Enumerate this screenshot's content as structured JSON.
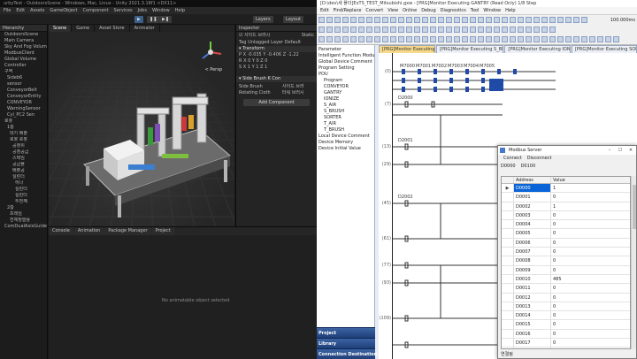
{
  "unity": {
    "title": "urbyTest - OutdoorsScene - Windows, Mac, Linux - Unity 2021.3.18f1 <DX11>",
    "menu": [
      "File",
      "Edit",
      "Assets",
      "GameObject",
      "Component",
      "Services",
      "Jobs",
      "Window",
      "Help"
    ],
    "toolbar": {
      "layers": "Layers",
      "layout": "Layout"
    },
    "hierarchy": {
      "tab": "Hierarchy",
      "items": [
        "OutdoorsScene",
        "Main Camera",
        "Sky And Fog Volume",
        "ModbusClient",
        "Global Volume",
        "Controller",
        "구역",
        "Sideb6",
        "sensor",
        "ConveyorBelt",
        "ConveyorEntity",
        "CONVEYOR",
        "WarningSensor",
        "Cyl_PC2 Sen",
        "로봇",
        "1층",
        "대기 배출",
        "로봇 로봇",
        "공정위",
        "공정공급",
        "스택임",
        "공급폴",
        "배출공",
        "실린더",
        "하나",
        "실린더",
        "실린더",
        "두번째",
        "2층",
        "프레임",
        "전체정렬용",
        "ComDualAxisGuide"
      ]
    },
    "scene": {
      "tabs": [
        "Scene",
        "Game",
        "Asset Store",
        "Animator"
      ],
      "persp_label": "< Persp"
    },
    "inspector": {
      "tab": "Inspector",
      "object_name": "사이드 브러시",
      "static_label": "Static",
      "tag_label": "Tag",
      "tag_value": "Untagged",
      "layer_label": "Layer",
      "layer_value": "Default",
      "transform_label": "Transform",
      "rows": [
        {
          "axis": "P",
          "x": "X -0.035",
          "y": "Y -0.406",
          "z": "Z -1.22"
        },
        {
          "axis": "R",
          "x": "X 0",
          "y": "Y 0",
          "z": "Z 0"
        },
        {
          "axis": "S",
          "x": "X 1",
          "y": "Y 1",
          "z": "Z 1"
        }
      ],
      "component_label": "Side Brush K Con",
      "side_brush_label": "Side Brush",
      "side_brush_value": "사이드 브러",
      "rotating_label": "Rotating Cloth",
      "rotating_value": "타워 브러시",
      "add_component": "Add Component"
    },
    "console": {
      "tabs": [
        "Console",
        "Animation",
        "Package Manager",
        "Project"
      ],
      "empty_text": "No animatable object selected"
    }
  },
  "gx": {
    "title": "[PRG]Monitor Executing GANTRY (Read Only) 1/8 Step",
    "path_text": "[D:\\dev\\새 폴더]ExTS_TEST_Mitsubishi.gxw",
    "menu": [
      "Edit",
      "Find/Replace",
      "Convert",
      "View",
      "Online",
      "Debug",
      "Diagnostics",
      "Tool",
      "Window",
      "Help"
    ],
    "zoom": "100.000ms",
    "nav_items": [
      "Parameter",
      "Intelligent Function Module",
      "Global Device Comment",
      "Program Setting",
      "POU",
      "Program",
      "CONVEYOR",
      "GANTRY",
      "IONIZE",
      "S_AIR",
      "S_BRUSH",
      "SORTER",
      "T_AIR",
      "T_BRUSH",
      "Local Device Comment",
      "Device Memory",
      "Device Initial Value"
    ],
    "nav_bars": [
      "Project",
      "Library",
      "Connection Destination"
    ],
    "doc_tabs": [
      "[PRG]Monitor Executing G...",
      "[PRG]Monitor Executing S_BRUS...",
      "[PRG]Monitor Executing IONIZE...",
      "[PRG]Monitor Executing SORTE..."
    ],
    "line_numbers": [
      "(0)",
      "(7)",
      "(13)",
      "(29)",
      "(45)",
      "(61)",
      "(77)",
      "(93)",
      "(109)"
    ],
    "registers": [
      "M7000",
      "M7001",
      "M7002",
      "M7003",
      "M7004",
      "M7005",
      "D2000",
      "D2001",
      "D2002"
    ]
  },
  "modbus": {
    "title": "Modbus Server",
    "menu": [
      "Connect",
      "Disconnect"
    ],
    "range_from": "D0000",
    "range_to": "D0100",
    "columns": [
      "Address",
      "Value"
    ],
    "rows": [
      {
        "address": "D0000",
        "value": "1"
      },
      {
        "address": "D0001",
        "value": "0"
      },
      {
        "address": "D0002",
        "value": "1"
      },
      {
        "address": "D0003",
        "value": "0"
      },
      {
        "address": "D0004",
        "value": "0"
      },
      {
        "address": "D0005",
        "value": "0"
      },
      {
        "address": "D0006",
        "value": "0"
      },
      {
        "address": "D0007",
        "value": "0"
      },
      {
        "address": "D0008",
        "value": "0"
      },
      {
        "address": "D0009",
        "value": "0"
      },
      {
        "address": "D0010",
        "value": "485"
      },
      {
        "address": "D0011",
        "value": "0"
      },
      {
        "address": "D0012",
        "value": "0"
      },
      {
        "address": "D0013",
        "value": "0"
      },
      {
        "address": "D0014",
        "value": "0"
      },
      {
        "address": "D0015",
        "value": "0"
      },
      {
        "address": "D0016",
        "value": "0"
      },
      {
        "address": "D0017",
        "value": "0"
      },
      {
        "address": "D0018",
        "value": "0"
      }
    ],
    "status": "연결됨",
    "colors": {
      "selection": "#0a64d8"
    }
  }
}
